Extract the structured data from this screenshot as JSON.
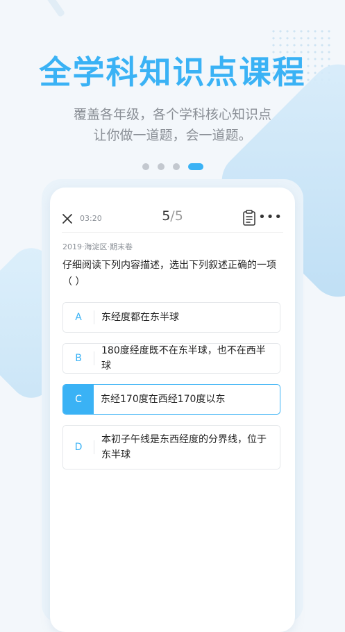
{
  "hero": {
    "title": "全学科知识点课程",
    "subtitle_line1": "覆盖各年级，各个学科核心知识点",
    "subtitle_line2": "让你做一道题，会一道题。"
  },
  "pager": {
    "count": 4,
    "active_index": 3
  },
  "quiz": {
    "timer": "03:20",
    "progress_current": "5",
    "progress_sep": "/",
    "progress_total": "5",
    "meta": "2019·海淀区·期末卷",
    "question": "仔细阅读下列内容描述，选出下列叙述正确的一项（     ）",
    "options": [
      {
        "letter": "A",
        "text": "东经度都在东半球"
      },
      {
        "letter": "B",
        "text": "180度经度既不在东半球，也不在西半球"
      },
      {
        "letter": "C",
        "text": "东经170度在西经170度以东"
      },
      {
        "letter": "D",
        "text": "本初子午线是东西经度的分界线，位于东半球"
      }
    ],
    "selected_option": "C"
  },
  "colors": {
    "accent": "#3ab2f5",
    "text": "#222222",
    "muted": "#8a8f96"
  },
  "icons": {
    "close": "close-icon",
    "note": "note-icon",
    "more": "more-icon"
  }
}
